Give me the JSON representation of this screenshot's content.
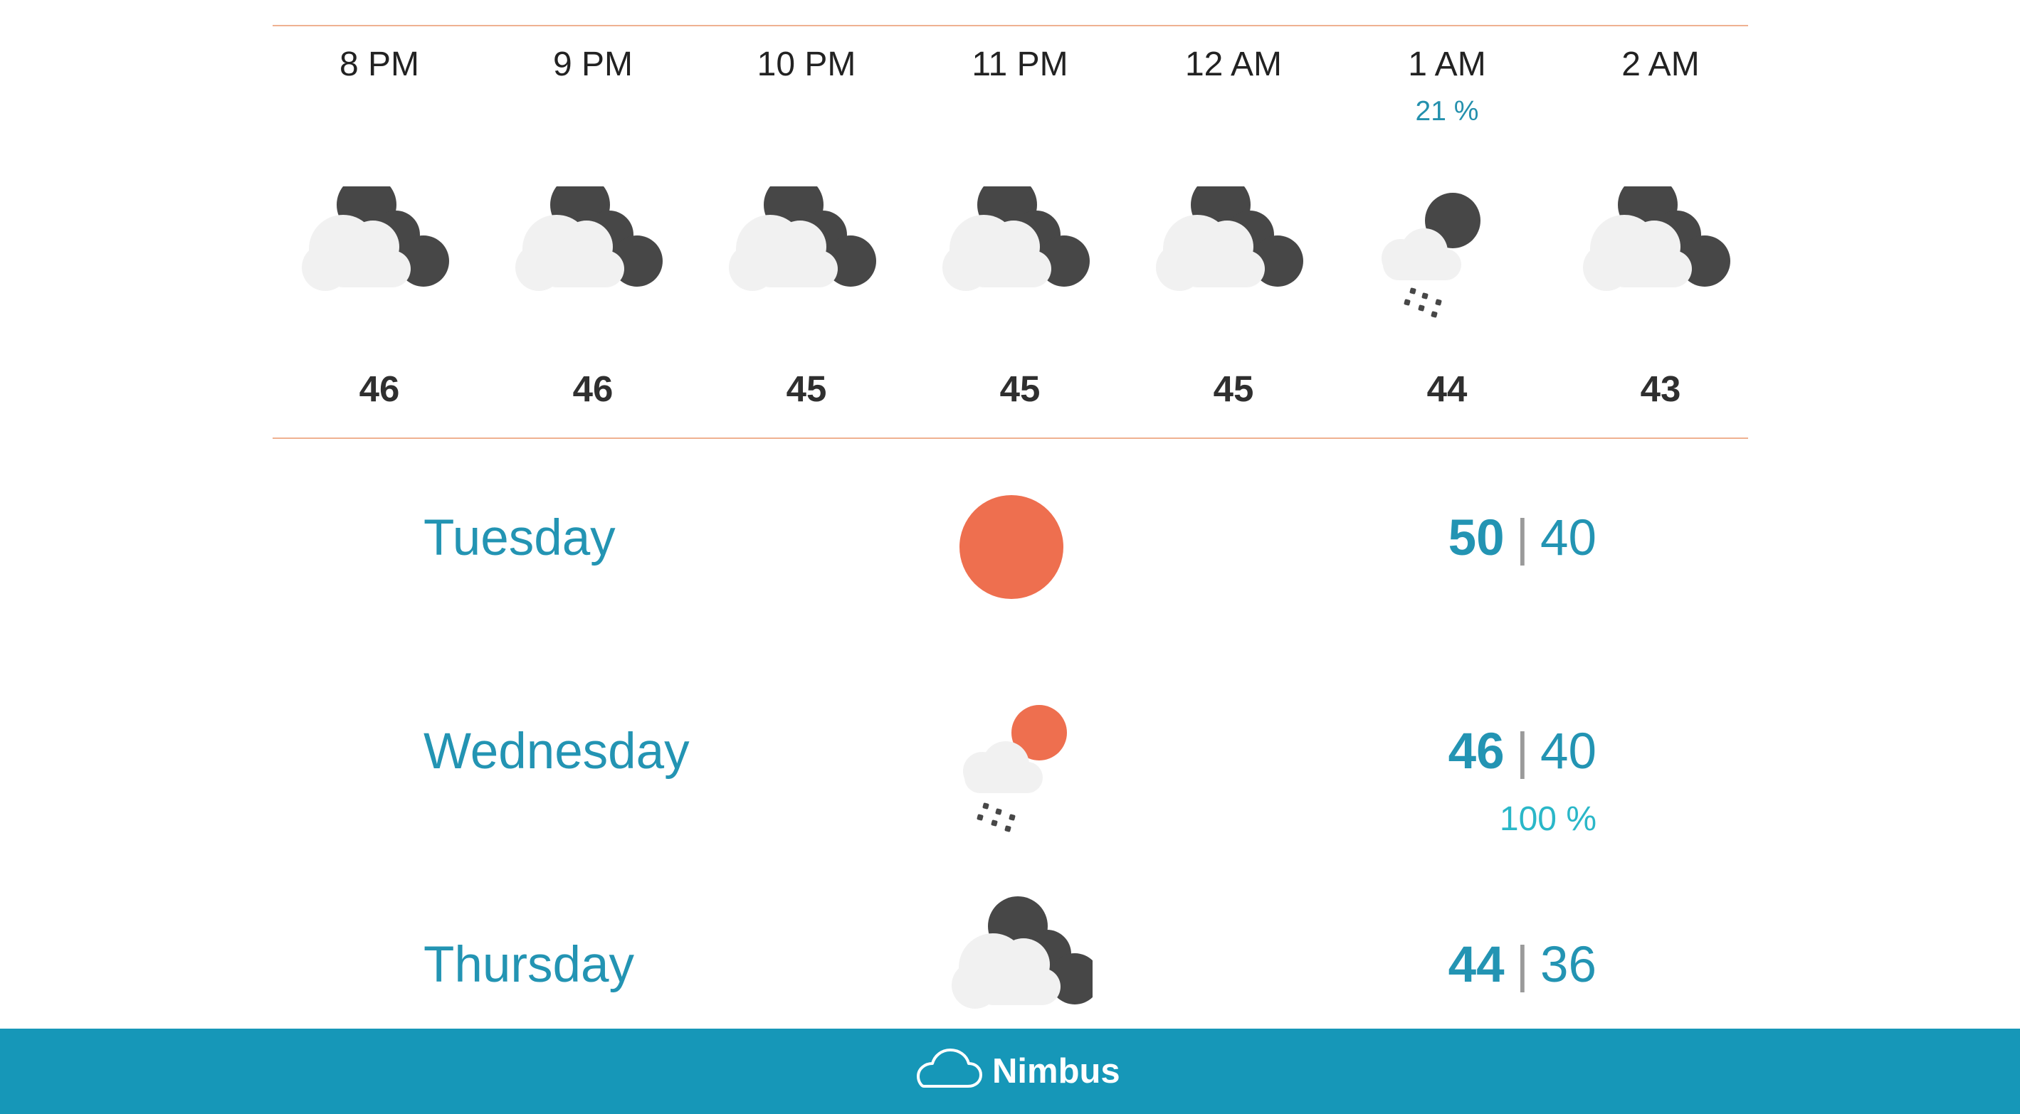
{
  "hourly": [
    {
      "time": "8 PM",
      "precip": "",
      "temp": "46",
      "icon": "partly-cloudy-night-icon"
    },
    {
      "time": "9 PM",
      "precip": "",
      "temp": "46",
      "icon": "partly-cloudy-night-icon"
    },
    {
      "time": "10 PM",
      "precip": "",
      "temp": "45",
      "icon": "partly-cloudy-night-icon"
    },
    {
      "time": "11 PM",
      "precip": "",
      "temp": "45",
      "icon": "partly-cloudy-night-icon"
    },
    {
      "time": "12 AM",
      "precip": "",
      "temp": "45",
      "icon": "partly-cloudy-night-icon"
    },
    {
      "time": "1 AM",
      "precip": "21 %",
      "temp": "44",
      "icon": "rain-night-icon"
    },
    {
      "time": "2 AM",
      "precip": "",
      "temp": "43",
      "icon": "partly-cloudy-night-icon"
    }
  ],
  "daily": [
    {
      "day": "Tuesday",
      "high": "50",
      "separator": "|",
      "low": "40",
      "precip": "",
      "icon": "sunny-icon"
    },
    {
      "day": "Wednesday",
      "high": "46",
      "separator": "|",
      "low": "40",
      "precip": "100 %",
      "icon": "rain-sun-icon"
    },
    {
      "day": "Thursday",
      "high": "44",
      "separator": "|",
      "low": "36",
      "precip": "",
      "icon": "partly-cloudy-night-icon"
    }
  ],
  "footer": {
    "brand": "Nimbus",
    "icon": "cloud-outline-icon"
  },
  "colors": {
    "accent": "#2394b3",
    "footer": "#1697b8",
    "divider": "#efb191",
    "sun": "#ee6f4f",
    "cloud": "#f1f1f1",
    "moon": "#474747",
    "text": "#222222",
    "precip": "#2490ad"
  }
}
